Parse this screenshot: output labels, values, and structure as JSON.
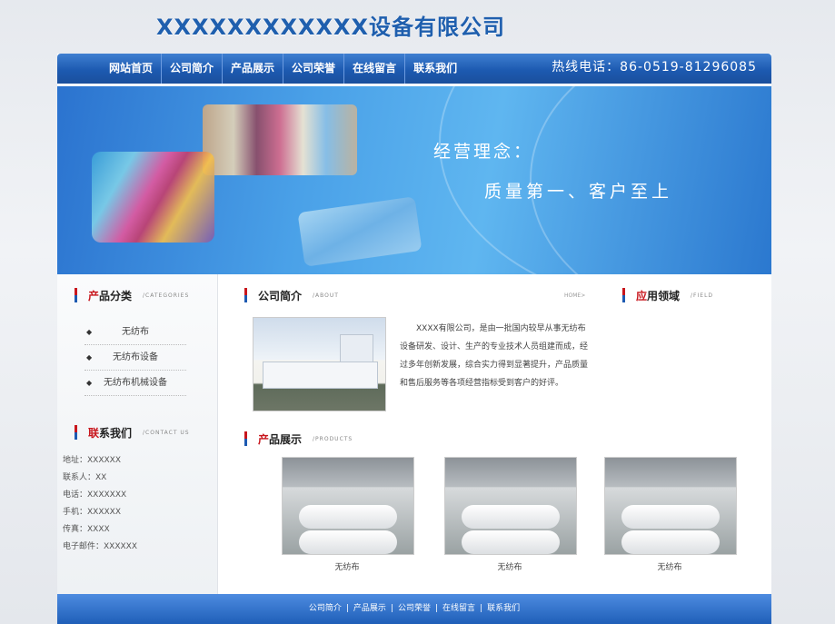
{
  "site": {
    "title": "XXXXXXXXXXXX设备有限公司"
  },
  "nav": {
    "items": [
      "网站首页",
      "公司简介",
      "产品展示",
      "公司荣誉",
      "在线留言",
      "联系我们"
    ],
    "hotline": "热线电话：86-0519-81296085"
  },
  "banner": {
    "slogan_title": "经营理念：",
    "slogan_text": "质量第一、客户至上"
  },
  "categories": {
    "title_first": "产",
    "title_rest": "品分类",
    "en": "/CATEGORIES",
    "items": [
      "无纺布",
      "无纺布设备",
      "无纺布机械设备"
    ]
  },
  "contact": {
    "title_first": "联",
    "title_rest": "系我们",
    "en": "/CONTACT US",
    "rows": [
      "地址：XXXXXX",
      "联系人：XX",
      "电话：XXXXXXX",
      "手机：XXXXXX",
      "传真：XXXX",
      "电子邮件：XXXXXX"
    ]
  },
  "about": {
    "title": "公司简介",
    "en": "/ABOUT",
    "home_link": "HOME>",
    "text": "XXXX有限公司，是由一批国内较早从事无纺布设备研发、设计、生产的专业技术人员组建而成，经过多年创新发展，综合实力得到显著提升，产品质量和售后服务等各项经营指标受到客户的好评。"
  },
  "application": {
    "title_first": "应",
    "title_rest": "用领域",
    "en": "/FIELD"
  },
  "products": {
    "title_first": "产",
    "title_rest": "品展示",
    "en": "/PRODUCTS",
    "items": [
      {
        "caption": "无纺布"
      },
      {
        "caption": "无纺布"
      },
      {
        "caption": "无纺布"
      }
    ]
  },
  "footer": {
    "links": [
      "公司简介",
      "产品展示",
      "公司荣誉",
      "在线留言",
      "联系我们"
    ]
  },
  "colors": {
    "brand_blue": "#1d5ab1",
    "accent_red": "#c8161d"
  }
}
